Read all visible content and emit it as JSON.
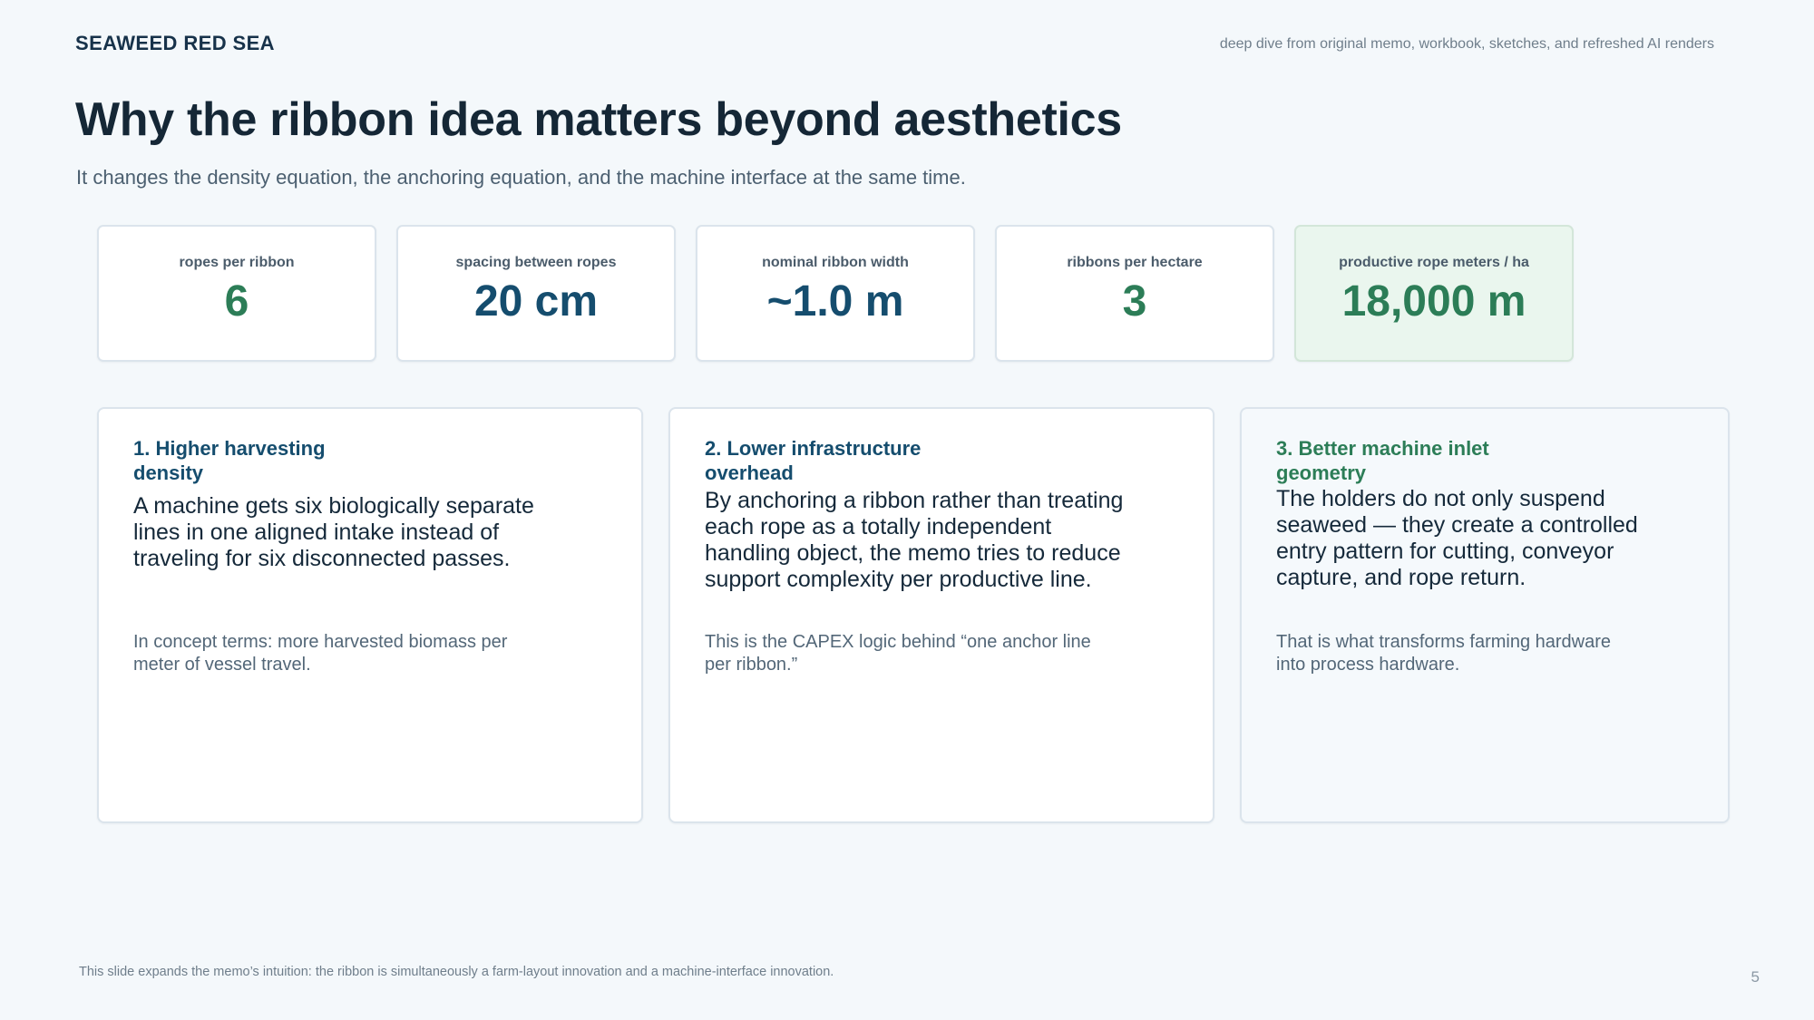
{
  "header": {
    "brand": "SEAWEED RED SEA",
    "source_note": "deep dive from original memo, workbook, sketches, and refreshed AI renders"
  },
  "title": "Why the ribbon idea matters beyond aesthetics",
  "subtitle": "It changes the density equation, the anchoring equation, and the machine interface at the same time.",
  "stats": [
    {
      "label": "ropes per ribbon",
      "value": "6",
      "color": "#2c7d57"
    },
    {
      "label": "spacing between ropes",
      "value": "20 cm",
      "color": "#154d6e"
    },
    {
      "label": "nominal ribbon width",
      "value": "~1.0 m",
      "color": "#154d6e"
    },
    {
      "label": "ribbons per hectare",
      "value": "3",
      "color": "#2c7d57"
    },
    {
      "label": "productive rope meters / ha",
      "value": "18,000 m",
      "color": "#2c7d57"
    }
  ],
  "cards": [
    {
      "heading": "1. Higher harvesting density",
      "body": "A machine gets six biologically separate lines in one aligned intake instead of traveling for six disconnected passes.",
      "note": "In concept terms: more harvested biomass per meter of vessel travel."
    },
    {
      "heading": "2. Lower infrastructure overhead",
      "body": "By anchoring a ribbon rather than treating each rope as a totally independent handling object, the memo tries to reduce support complexity per productive line.",
      "note": "This is the CAPEX logic behind “one anchor line per ribbon.”"
    },
    {
      "heading": "3. Better machine inlet geometry",
      "body": "The holders do not only suspend seaweed — they create a controlled entry pattern for cutting, conveyor capture, and rope return.",
      "note": "That is what transforms farming hardware into process hardware."
    }
  ],
  "footer": {
    "note": "This slide expands the memo’s intuition: the ribbon is simultaneously a farm-layout innovation and a machine-interface innovation.",
    "page_number": "5"
  }
}
